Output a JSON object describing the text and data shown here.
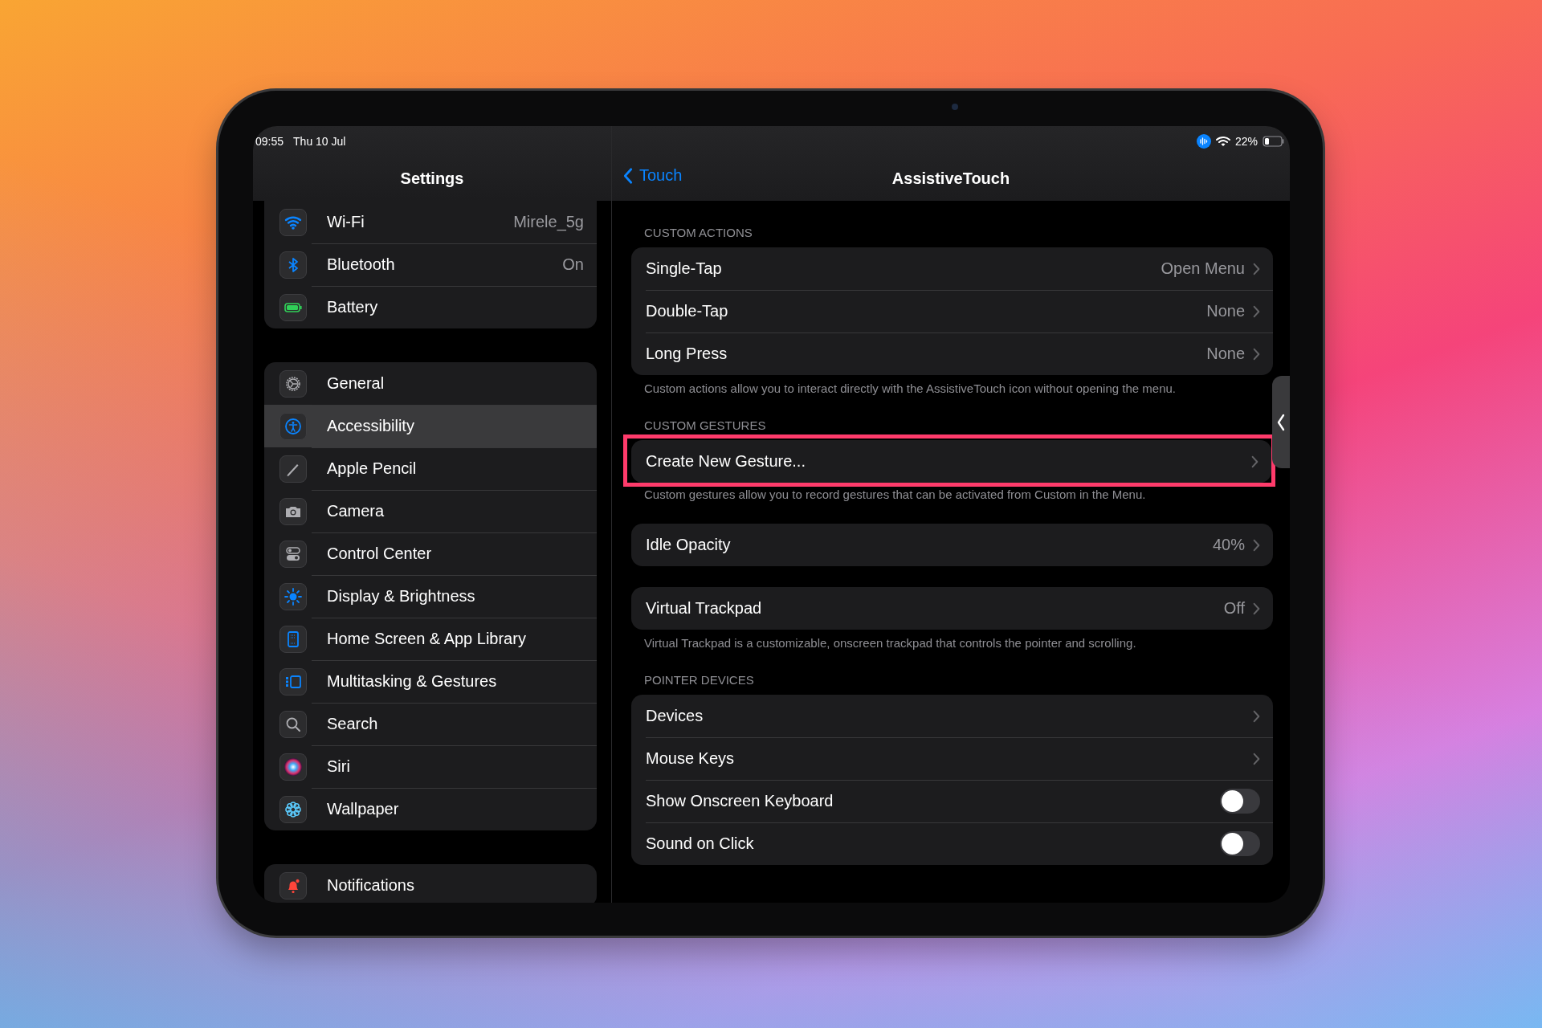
{
  "status_bar": {
    "time": "09:55",
    "date": "Thu 10 Jul",
    "battery": "22%"
  },
  "sidebar": {
    "title": "Settings",
    "groups": [
      {
        "items": [
          {
            "kind": "wifi",
            "label": "Wi-Fi",
            "value": "Mirele_5g",
            "selected": false
          },
          {
            "kind": "bluetooth",
            "label": "Bluetooth",
            "value": "On",
            "selected": false
          },
          {
            "kind": "battery",
            "label": "Battery",
            "selected": false
          }
        ]
      },
      {
        "items": [
          {
            "kind": "gear",
            "label": "General",
            "selected": false
          },
          {
            "kind": "accessibility",
            "label": "Accessibility",
            "selected": true
          },
          {
            "kind": "pencil",
            "label": "Apple Pencil",
            "selected": false
          },
          {
            "kind": "camera",
            "label": "Camera",
            "selected": false
          },
          {
            "kind": "switches",
            "label": "Control Center",
            "selected": false
          },
          {
            "kind": "sun",
            "label": "Display & Brightness",
            "selected": false
          },
          {
            "kind": "homescreen",
            "label": "Home Screen & App Library",
            "selected": false
          },
          {
            "kind": "multitask",
            "label": "Multitasking & Gestures",
            "selected": false
          },
          {
            "kind": "search",
            "label": "Search",
            "selected": false
          },
          {
            "kind": "siri",
            "label": "Siri",
            "selected": false
          },
          {
            "kind": "flower",
            "label": "Wallpaper",
            "selected": false
          }
        ]
      },
      {
        "items": [
          {
            "kind": "bell",
            "label": "Notifications",
            "selected": false
          }
        ]
      }
    ]
  },
  "detail": {
    "back": "Touch",
    "title": "AssistiveTouch",
    "sections": [
      {
        "header": "CUSTOM ACTIONS",
        "highlighted": false,
        "rows": [
          {
            "kind": "disclosure",
            "label": "Single-Tap",
            "value": "Open Menu"
          },
          {
            "kind": "disclosure",
            "label": "Double-Tap",
            "value": "None"
          },
          {
            "kind": "disclosure",
            "label": "Long Press",
            "value": "None"
          }
        ],
        "footer": "Custom actions allow you to interact directly with the AssistiveTouch icon without opening the menu."
      },
      {
        "header": "CUSTOM GESTURES",
        "highlighted": true,
        "rows": [
          {
            "kind": "disclosure",
            "label": "Create New Gesture..."
          }
        ],
        "footer": "Custom gestures allow you to record gestures that can be activated from Custom in the Menu."
      },
      {
        "highlighted": false,
        "rows": [
          {
            "kind": "disclosure",
            "label": "Idle Opacity",
            "value": "40%"
          }
        ]
      },
      {
        "highlighted": false,
        "rows": [
          {
            "kind": "disclosure",
            "label": "Virtual Trackpad",
            "value": "Off"
          }
        ],
        "footer": "Virtual Trackpad is a customizable, onscreen trackpad that controls the pointer and scrolling."
      },
      {
        "header": "POINTER DEVICES",
        "highlighted": false,
        "rows": [
          {
            "kind": "disclosure",
            "label": "Devices"
          },
          {
            "kind": "disclosure",
            "label": "Mouse Keys"
          },
          {
            "kind": "toggle",
            "label": "Show Onscreen Keyboard",
            "on": false
          },
          {
            "kind": "toggle",
            "label": "Sound on Click",
            "on": false
          }
        ]
      }
    ]
  }
}
